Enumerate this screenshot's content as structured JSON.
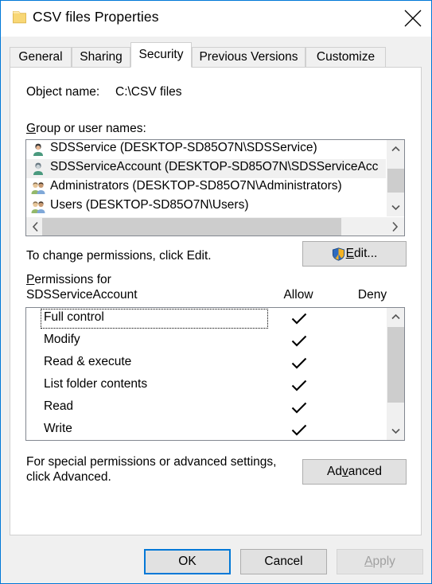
{
  "window": {
    "title": "CSV files Properties",
    "folder_icon": "folder-icon",
    "close_icon": "close-icon",
    "border_color": "#0078d7"
  },
  "tabs": [
    {
      "label": "General",
      "active": false
    },
    {
      "label": "Sharing",
      "active": false
    },
    {
      "label": "Security",
      "active": true
    },
    {
      "label": "Previous Versions",
      "active": false
    },
    {
      "label": "Customize",
      "active": false
    }
  ],
  "security": {
    "object_name_label": "Object name:",
    "object_name_value": "C:\\CSV files",
    "group_label_accel": "G",
    "group_label_rest": "roup or user names:",
    "group_list": [
      {
        "name": "SDSService (DESKTOP-SD85O7N\\SDSService)",
        "icon": "user-icon",
        "selected": false
      },
      {
        "name": "SDSServiceAccount (DESKTOP-SD85O7N\\SDSServiceAcc",
        "icon": "user-icon",
        "selected": true
      },
      {
        "name": "Administrators (DESKTOP-SD85O7N\\Administrators)",
        "icon": "group-icon",
        "selected": false
      },
      {
        "name": "Users (DESKTOP-SD85O7N\\Users)",
        "icon": "group-icon",
        "selected": false
      }
    ],
    "change_permissions_text": "To change permissions, click Edit.",
    "edit_button": {
      "accel": "E",
      "rest": "dit...",
      "icon": "uac-shield-icon"
    },
    "permissions_for_line1_accel": "P",
    "permissions_for_line1_rest": "ermissions for",
    "permissions_for_line2": "SDSServiceAccount",
    "allow_header": "Allow",
    "deny_header": "Deny",
    "permissions": [
      {
        "label": "Full control",
        "allow": true,
        "deny": false,
        "focused": true
      },
      {
        "label": "Modify",
        "allow": true,
        "deny": false,
        "focused": false
      },
      {
        "label": "Read & execute",
        "allow": true,
        "deny": false,
        "focused": false
      },
      {
        "label": "List folder contents",
        "allow": true,
        "deny": false,
        "focused": false
      },
      {
        "label": "Read",
        "allow": true,
        "deny": false,
        "focused": false
      },
      {
        "label": "Write",
        "allow": true,
        "deny": false,
        "focused": false
      }
    ],
    "advanced_text_line1": "For special permissions or advanced settings,",
    "advanced_text_line2": "click Advanced.",
    "advanced_button": {
      "pre": "Ad",
      "accel": "v",
      "rest": "anced"
    }
  },
  "footer": {
    "ok_label": "OK",
    "cancel_label": "Cancel",
    "apply_accel": "A",
    "apply_rest": "pply",
    "apply_disabled": true
  },
  "scrollbars": {
    "up_arrow_icon": "chevron-up-icon",
    "down_arrow_icon": "chevron-down-icon",
    "left_arrow_icon": "chevron-left-icon",
    "right_arrow_icon": "chevron-right-icon"
  }
}
